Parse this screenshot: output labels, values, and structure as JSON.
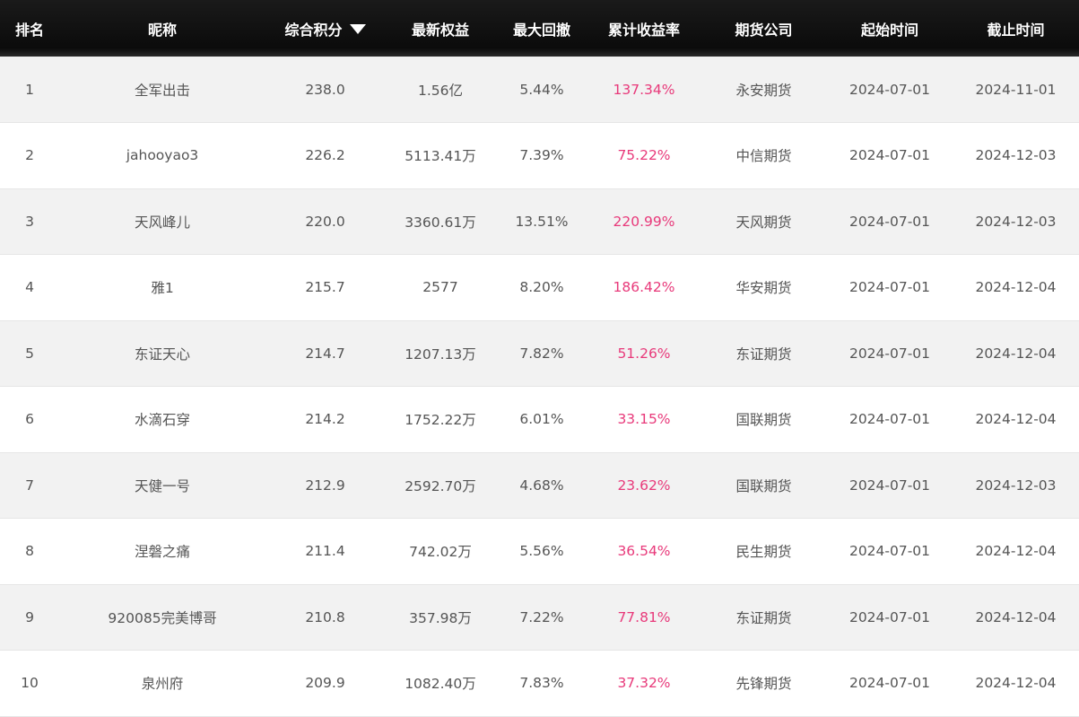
{
  "headers": {
    "rank": "排名",
    "nickname": "昵称",
    "score": "综合积分",
    "equity": "最新权益",
    "drawdown": "最大回撤",
    "return_rate": "累计收益率",
    "company": "期货公司",
    "start": "起始时间",
    "end": "截止时间"
  },
  "sort": {
    "column": "score",
    "direction": "desc",
    "icon": "sort-desc-icon"
  },
  "colors": {
    "header_bg": "#0b0b0b",
    "header_text": "#ffffff",
    "row_odd": "#f2f2f2",
    "row_even": "#ffffff",
    "text": "#555555",
    "return_accent": "#e8397a"
  },
  "rows": [
    {
      "rank": "1",
      "nickname": "全军出击",
      "score": "238.0",
      "equity": "1.56亿",
      "drawdown": "5.44%",
      "return_rate": "137.34%",
      "company": "永安期货",
      "start": "2024-07-01",
      "end": "2024-11-01"
    },
    {
      "rank": "2",
      "nickname": "jahooyao3",
      "score": "226.2",
      "equity": "5113.41万",
      "drawdown": "7.39%",
      "return_rate": "75.22%",
      "company": "中信期货",
      "start": "2024-07-01",
      "end": "2024-12-03"
    },
    {
      "rank": "3",
      "nickname": "天风峰儿",
      "score": "220.0",
      "equity": "3360.61万",
      "drawdown": "13.51%",
      "return_rate": "220.99%",
      "company": "天风期货",
      "start": "2024-07-01",
      "end": "2024-12-03"
    },
    {
      "rank": "4",
      "nickname": "雅1",
      "score": "215.7",
      "equity": "2577",
      "drawdown": "8.20%",
      "return_rate": "186.42%",
      "company": "华安期货",
      "start": "2024-07-01",
      "end": "2024-12-04"
    },
    {
      "rank": "5",
      "nickname": "东证天心",
      "score": "214.7",
      "equity": "1207.13万",
      "drawdown": "7.82%",
      "return_rate": "51.26%",
      "company": "东证期货",
      "start": "2024-07-01",
      "end": "2024-12-04"
    },
    {
      "rank": "6",
      "nickname": "水滴石穿",
      "score": "214.2",
      "equity": "1752.22万",
      "drawdown": "6.01%",
      "return_rate": "33.15%",
      "company": "国联期货",
      "start": "2024-07-01",
      "end": "2024-12-04"
    },
    {
      "rank": "7",
      "nickname": "天健一号",
      "score": "212.9",
      "equity": "2592.70万",
      "drawdown": "4.68%",
      "return_rate": "23.62%",
      "company": "国联期货",
      "start": "2024-07-01",
      "end": "2024-12-03"
    },
    {
      "rank": "8",
      "nickname": "涅磐之痛",
      "score": "211.4",
      "equity": "742.02万",
      "drawdown": "5.56%",
      "return_rate": "36.54%",
      "company": "民生期货",
      "start": "2024-07-01",
      "end": "2024-12-04"
    },
    {
      "rank": "9",
      "nickname": "920085完美博哥",
      "score": "210.8",
      "equity": "357.98万",
      "drawdown": "7.22%",
      "return_rate": "77.81%",
      "company": "东证期货",
      "start": "2024-07-01",
      "end": "2024-12-04"
    },
    {
      "rank": "10",
      "nickname": "泉州府",
      "score": "209.9",
      "equity": "1082.40万",
      "drawdown": "7.83%",
      "return_rate": "37.32%",
      "company": "先锋期货",
      "start": "2024-07-01",
      "end": "2024-12-04"
    }
  ]
}
